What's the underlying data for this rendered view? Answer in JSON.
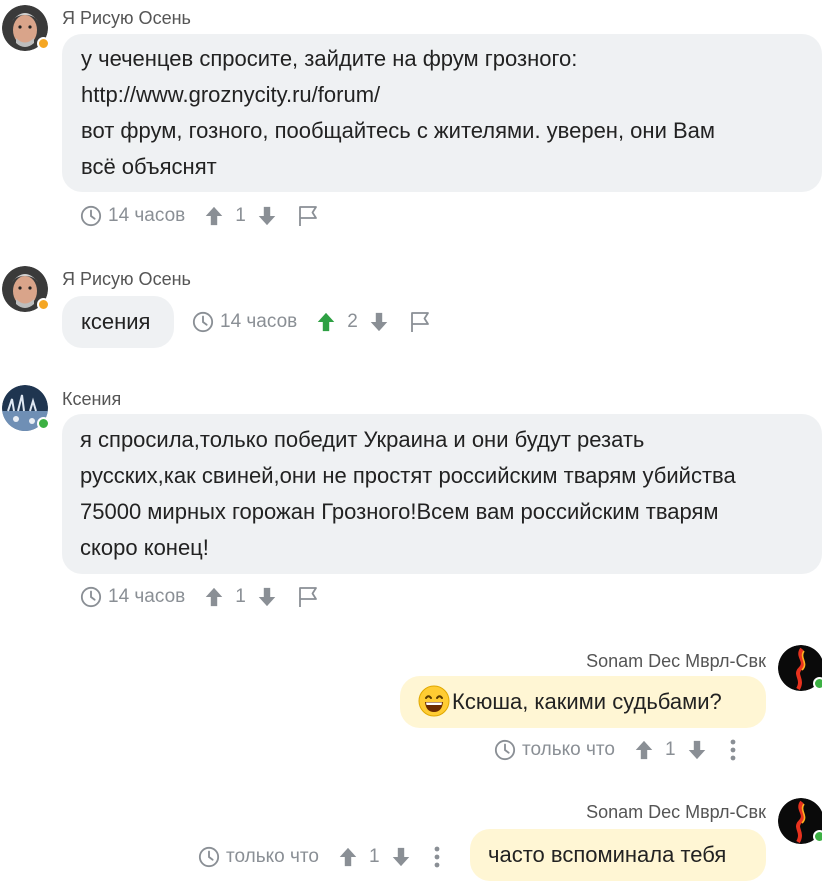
{
  "comments": [
    {
      "author": "Я Рисую Осень",
      "lines": [
        "у чеченцев спросите, зайдите на фрум грозного:",
        "http://www.groznycity.ru/forum/",
        "вот фрум, гозного, пообщайтесь с жителями. уверен, они Вам",
        "всё объяснят"
      ],
      "time": "14 часов",
      "votes": "1",
      "status_color": "#f5a623"
    },
    {
      "author": "Я Рисую Осень",
      "lines": [
        "ксения"
      ],
      "time": "14 часов",
      "votes": "2",
      "status_color": "#f5a623",
      "upvote_color": "#2ea043"
    },
    {
      "author": "Ксения",
      "lines": [
        "я спросила,только победит Украина и они будут резать",
        "русских,как свиней,они не простят российским тварям убийства",
        "75000 мирных горожан Грозного!Всем вам российским тварям",
        "скоро конец!"
      ],
      "time": "14 часов",
      "votes": "1",
      "status_color": "#3cb043"
    },
    {
      "author": "Sonam Dec Мврл-Свк",
      "emoji": "grinning-face-icon",
      "text": "Ксюша, какими судьбами?",
      "time": "только что",
      "votes": "1",
      "status_color": "#3cb043"
    },
    {
      "author": "Sonam Dec Мврл-Свк",
      "text": "часто вспоминала тебя",
      "time": "только что",
      "votes": "1",
      "status_color": "#3cb043"
    }
  ],
  "colors": {
    "bubble_other": "#eff1f3",
    "bubble_mine": "#fff6d4",
    "meta_grey": "#8a8f95",
    "online": "#3cb043",
    "away": "#f5a623"
  }
}
